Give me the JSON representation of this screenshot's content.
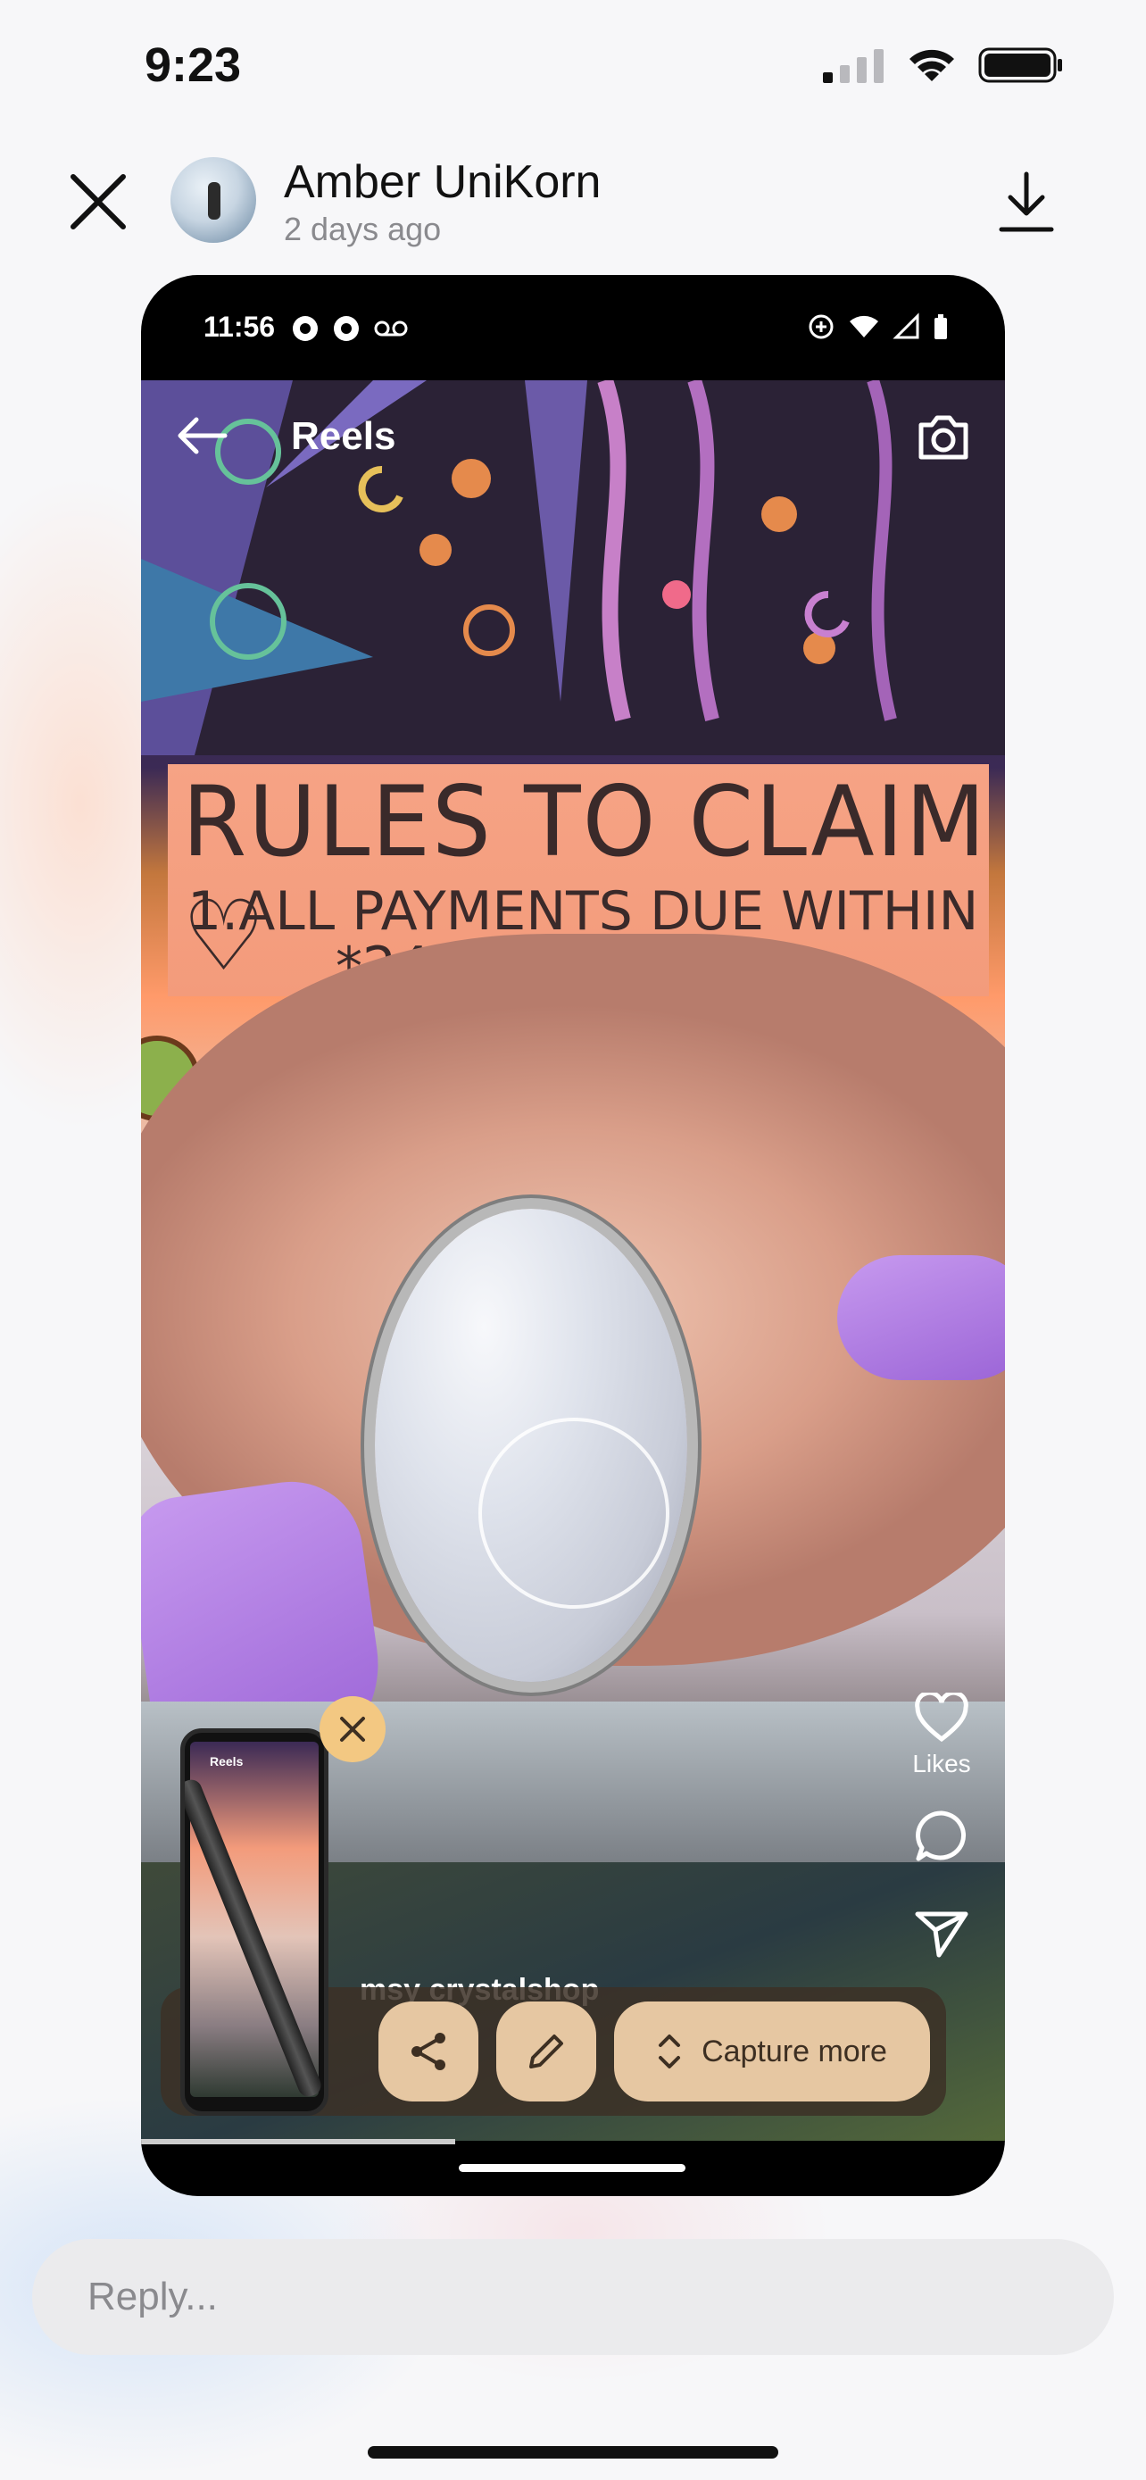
{
  "status_bar": {
    "time": "9:23"
  },
  "header": {
    "username": "Amber UniKorn",
    "time_ago": "2 days ago"
  },
  "screenshot": {
    "status_time": "11:56",
    "screen_title": "Reels",
    "sign_line1": "RULES TO CLAIM ♡",
    "sign_line2": "1.ALL PAYMENTS DUE WITHIN",
    "sign_line3": "*24 HOURS*",
    "likes_label": "Likes",
    "account_overlay": "msy crystalshop",
    "capture_more_label": "Capture more",
    "thumbnail_label": "Reels"
  },
  "reply": {
    "placeholder": "Reply..."
  },
  "colors": {
    "capture_button_bg": "#e6c7a2",
    "close_badge_bg": "#f3c882",
    "nail_purple": "#a56ae0"
  }
}
